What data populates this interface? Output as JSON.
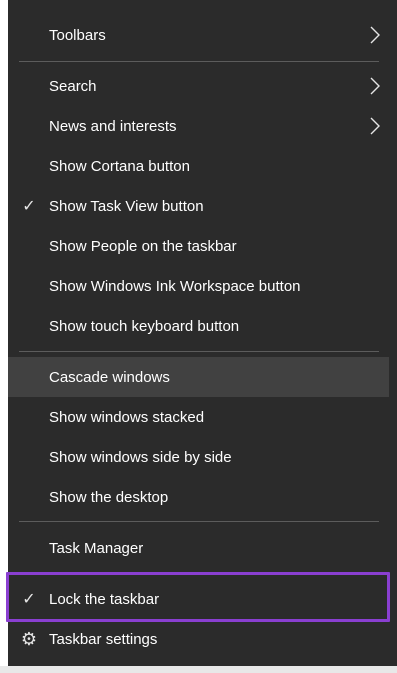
{
  "menu": {
    "toolbars": "Toolbars",
    "search": "Search",
    "news_and_interests": "News and interests",
    "show_cortana_button": "Show Cortana button",
    "show_task_view_button": "Show Task View button",
    "show_people": "Show People on the taskbar",
    "show_windows_ink": "Show Windows Ink Workspace button",
    "show_touch_keyboard": "Show touch keyboard button",
    "cascade_windows": "Cascade windows",
    "show_windows_stacked": "Show windows stacked",
    "show_windows_side_by_side": "Show windows side by side",
    "show_desktop": "Show the desktop",
    "task_manager": "Task Manager",
    "lock_taskbar": "Lock the taskbar",
    "taskbar_settings": "Taskbar settings"
  },
  "checkmark": "✓",
  "gear": "⚙",
  "colors": {
    "menu_bg": "#2b2b2b",
    "hover_bg": "#414141",
    "separator": "#5c5c5c",
    "highlight_box": "#8a3fd1"
  }
}
